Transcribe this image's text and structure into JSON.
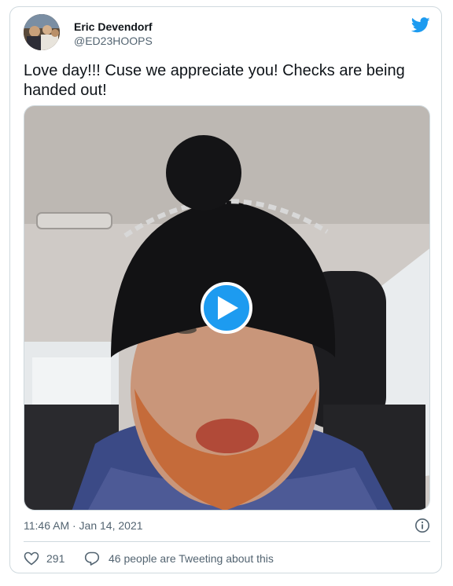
{
  "author": {
    "name": "Eric Devendorf",
    "handle": "@ED23HOOPS"
  },
  "tweet": {
    "text": "Love day!!! Cuse we appreciate you! Checks are being handed out!",
    "timestamp": "11:46 AM · Jan 14, 2021"
  },
  "engagement": {
    "likes": "291",
    "tweeting_about": "46 people are Tweeting about this"
  },
  "colors": {
    "accent": "#1d9bf0",
    "text": "#0f1419",
    "secondary": "#536471",
    "border": "#cfd9de"
  },
  "icons": [
    "twitter-bird-icon",
    "play-icon",
    "info-icon",
    "heart-icon",
    "reply-bubble-icon"
  ]
}
